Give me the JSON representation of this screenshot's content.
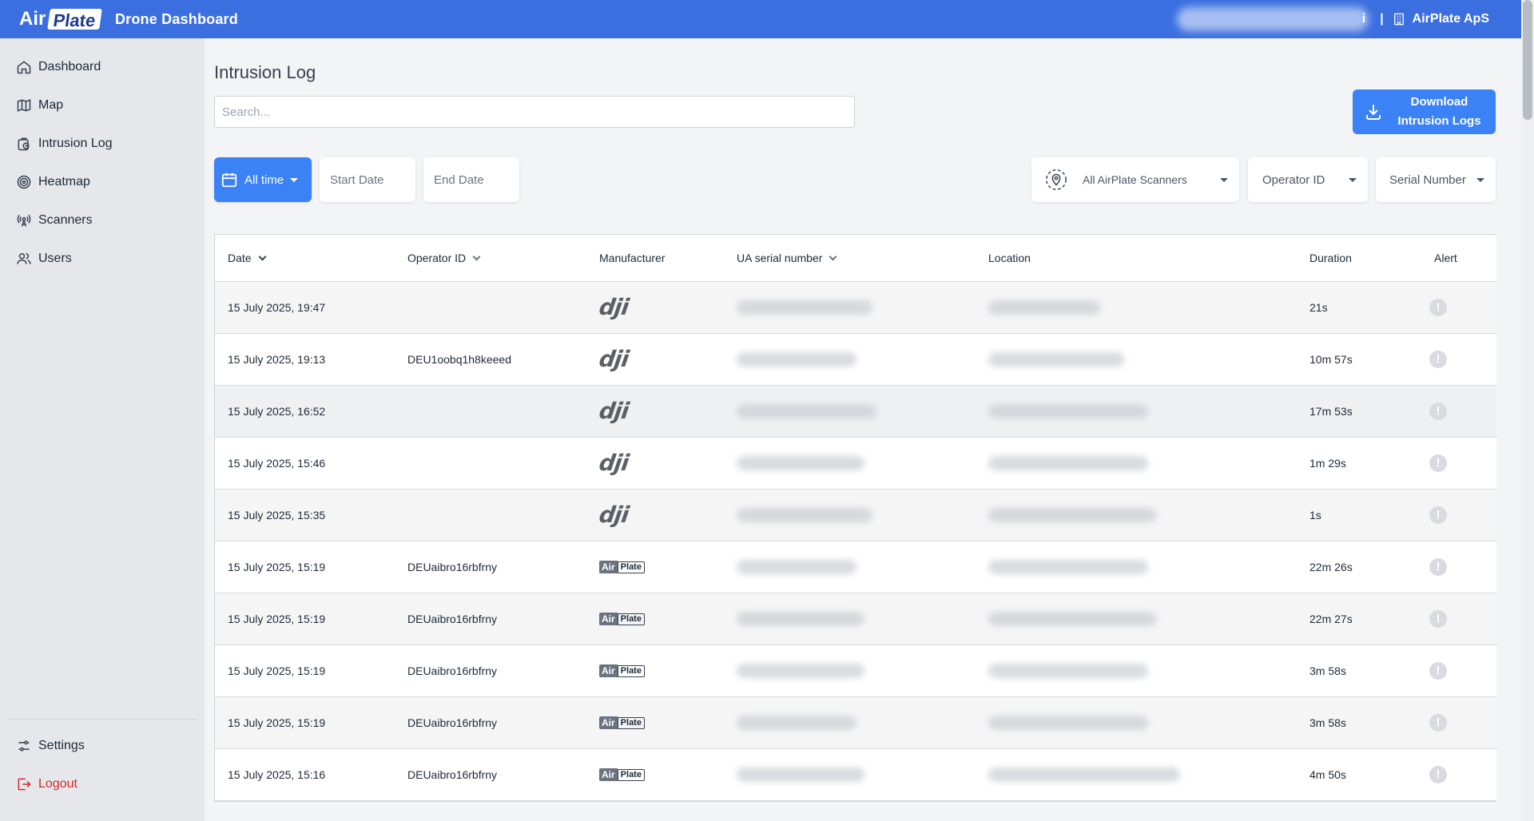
{
  "header": {
    "logo_air": "Air",
    "logo_plate": "Plate",
    "title": "Drone Dashboard",
    "user_tail": "i",
    "separator": "|",
    "org_name": "AirPlate ApS"
  },
  "sidebar": {
    "items": [
      {
        "label": "Dashboard",
        "icon": "home-icon"
      },
      {
        "label": "Map",
        "icon": "map-icon"
      },
      {
        "label": "Intrusion Log",
        "icon": "clock-log-icon"
      },
      {
        "label": "Heatmap",
        "icon": "target-icon"
      },
      {
        "label": "Scanners",
        "icon": "antenna-icon"
      },
      {
        "label": "Users",
        "icon": "users-icon"
      }
    ],
    "settings_label": "Settings",
    "logout_label": "Logout"
  },
  "main": {
    "title": "Intrusion Log",
    "search_placeholder": "Search...",
    "download_label_1": "Download",
    "download_label_2": "Intrusion Logs"
  },
  "filters": {
    "time_range": "All time",
    "start_date": "Start Date",
    "end_date": "End Date",
    "scanners": "All AirPlate Scanners",
    "operator_id": "Operator ID",
    "serial_number": "Serial Number"
  },
  "table": {
    "columns": {
      "date": "Date",
      "operator_id": "Operator ID",
      "manufacturer": "Manufacturer",
      "ua_serial": "UA serial number",
      "location": "Location",
      "duration": "Duration",
      "alert": "Alert"
    },
    "rows": [
      {
        "date": "15 July 2025, 19:47",
        "operator_id": "",
        "manufacturer": "dji",
        "duration": "21s"
      },
      {
        "date": "15 July 2025, 19:13",
        "operator_id": "DEU1oobq1h8keeed",
        "manufacturer": "dji",
        "duration": "10m 57s"
      },
      {
        "date": "15 July 2025, 16:52",
        "operator_id": "",
        "manufacturer": "dji",
        "duration": "17m 53s"
      },
      {
        "date": "15 July 2025, 15:46",
        "operator_id": "",
        "manufacturer": "dji",
        "duration": "1m 29s"
      },
      {
        "date": "15 July 2025, 15:35",
        "operator_id": "",
        "manufacturer": "dji",
        "duration": "1s"
      },
      {
        "date": "15 July 2025, 15:19",
        "operator_id": "DEUaibro16rbfrny",
        "manufacturer": "airplate",
        "duration": "22m 26s"
      },
      {
        "date": "15 July 2025, 15:19",
        "operator_id": "DEUaibro16rbfrny",
        "manufacturer": "airplate",
        "duration": "22m 27s"
      },
      {
        "date": "15 July 2025, 15:19",
        "operator_id": "DEUaibro16rbfrny",
        "manufacturer": "airplate",
        "duration": "3m 58s"
      },
      {
        "date": "15 July 2025, 15:19",
        "operator_id": "DEUaibro16rbfrny",
        "manufacturer": "airplate",
        "duration": "3m 58s"
      },
      {
        "date": "15 July 2025, 15:16",
        "operator_id": "DEUaibro16rbfrny",
        "manufacturer": "airplate",
        "duration": "4m 50s"
      }
    ]
  },
  "manufacturer_logos": {
    "dji": "dji",
    "airplate_air": "Air",
    "airplate_plate": "Plate"
  },
  "alert_glyph": "!",
  "colors": {
    "header_bg": "#3b6fe0",
    "accent": "#3b82f6",
    "logout": "#dc2626",
    "sidebar_bg": "#e5e7eb"
  }
}
